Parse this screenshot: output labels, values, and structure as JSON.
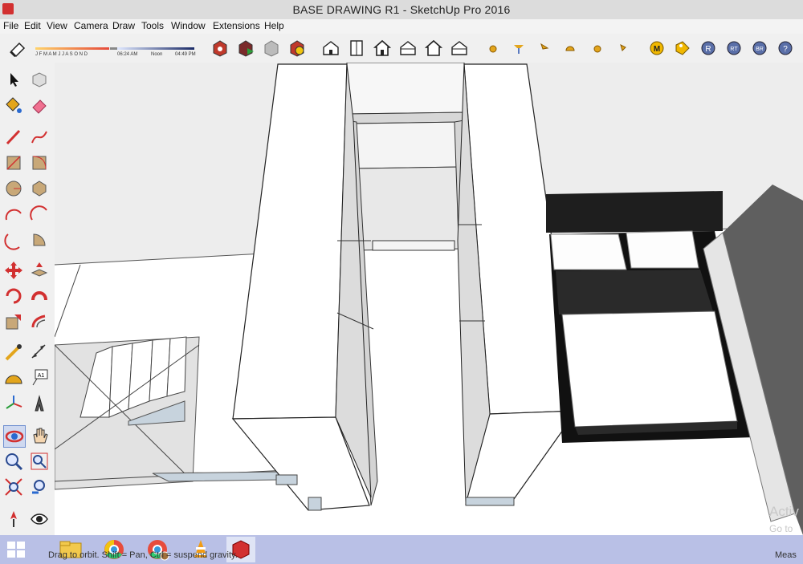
{
  "window": {
    "title": "BASE DRAWING R1 - SketchUp Pro 2016"
  },
  "menu": {
    "items": [
      "File",
      "Edit",
      "View",
      "Camera",
      "Draw",
      "Tools",
      "Window",
      "Extensions",
      "Help"
    ]
  },
  "shadow": {
    "months": "J F M A M J J A S O N D",
    "time_start": "06:24 AM",
    "time_mid": "Noon",
    "time_end": "04:49 PM"
  },
  "statusbar": {
    "hint": "Drag to orbit. Shift = Pan, Ctrl = suspend gravity.",
    "measurements_label": "Meas"
  },
  "watermark": {
    "line1": "Activ",
    "line2": "Go to"
  },
  "colors": {
    "titlebar": "#dcdcdc",
    "taskbar": "#b9c0e6",
    "viewport": "#ededed",
    "accent_red": "#d23030",
    "bed_dark": "#1e1e1e"
  }
}
